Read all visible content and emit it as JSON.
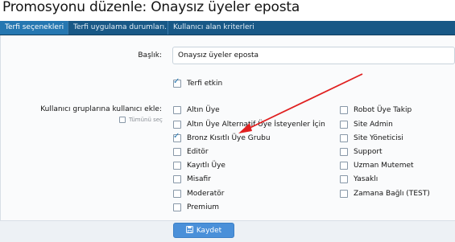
{
  "page": {
    "title": "Promosyonu düzenle: Onaysız üyeler eposta"
  },
  "tabs": [
    {
      "label": "Terfi seçenekleri",
      "active": true
    },
    {
      "label": "Terfi uygulama durumları...",
      "active": false
    },
    {
      "label": "Kullanıcı alan kriterleri",
      "active": false
    }
  ],
  "form": {
    "title_label": "Başlık:",
    "title_value": "Onaysız üyeler eposta",
    "active_label": "Terfi etkin",
    "active_checked": true,
    "groups_label": "Kullanıcı gruplarına kullanıcı ekle:",
    "select_all_label": "Tümünü seç"
  },
  "groups_left": [
    {
      "label": "Altın Üye",
      "checked": false
    },
    {
      "label": "Altın Üye Alternatif Üye İsteyenler İçin",
      "checked": false
    },
    {
      "label": "Bronz Kısıtlı Üye Grubu",
      "checked": true
    },
    {
      "label": "Editör",
      "checked": false
    },
    {
      "label": "Kayıtlı Üye",
      "checked": false
    },
    {
      "label": "Misafir",
      "checked": false
    },
    {
      "label": "Moderatör",
      "checked": false
    },
    {
      "label": "Premium",
      "checked": false
    }
  ],
  "groups_right": [
    {
      "label": "Robot Üye Takip",
      "checked": false
    },
    {
      "label": "Site Admin",
      "checked": false
    },
    {
      "label": "Site Yöneticisi",
      "checked": false
    },
    {
      "label": "Support",
      "checked": false
    },
    {
      "label": "Uzman Mutemet",
      "checked": false
    },
    {
      "label": "Yasaklı",
      "checked": false
    },
    {
      "label": "Zamana Bağlı (TEST)",
      "checked": false
    }
  ],
  "footer": {
    "save_label": "Kaydet"
  },
  "colors": {
    "tabbar": "#185886",
    "active_tab": "#2577b1",
    "button": "#4a90d9",
    "annotation_arrow": "#e02020"
  },
  "icons": {
    "checkbox_tick": "✓",
    "save": "floppy-disk-icon"
  }
}
